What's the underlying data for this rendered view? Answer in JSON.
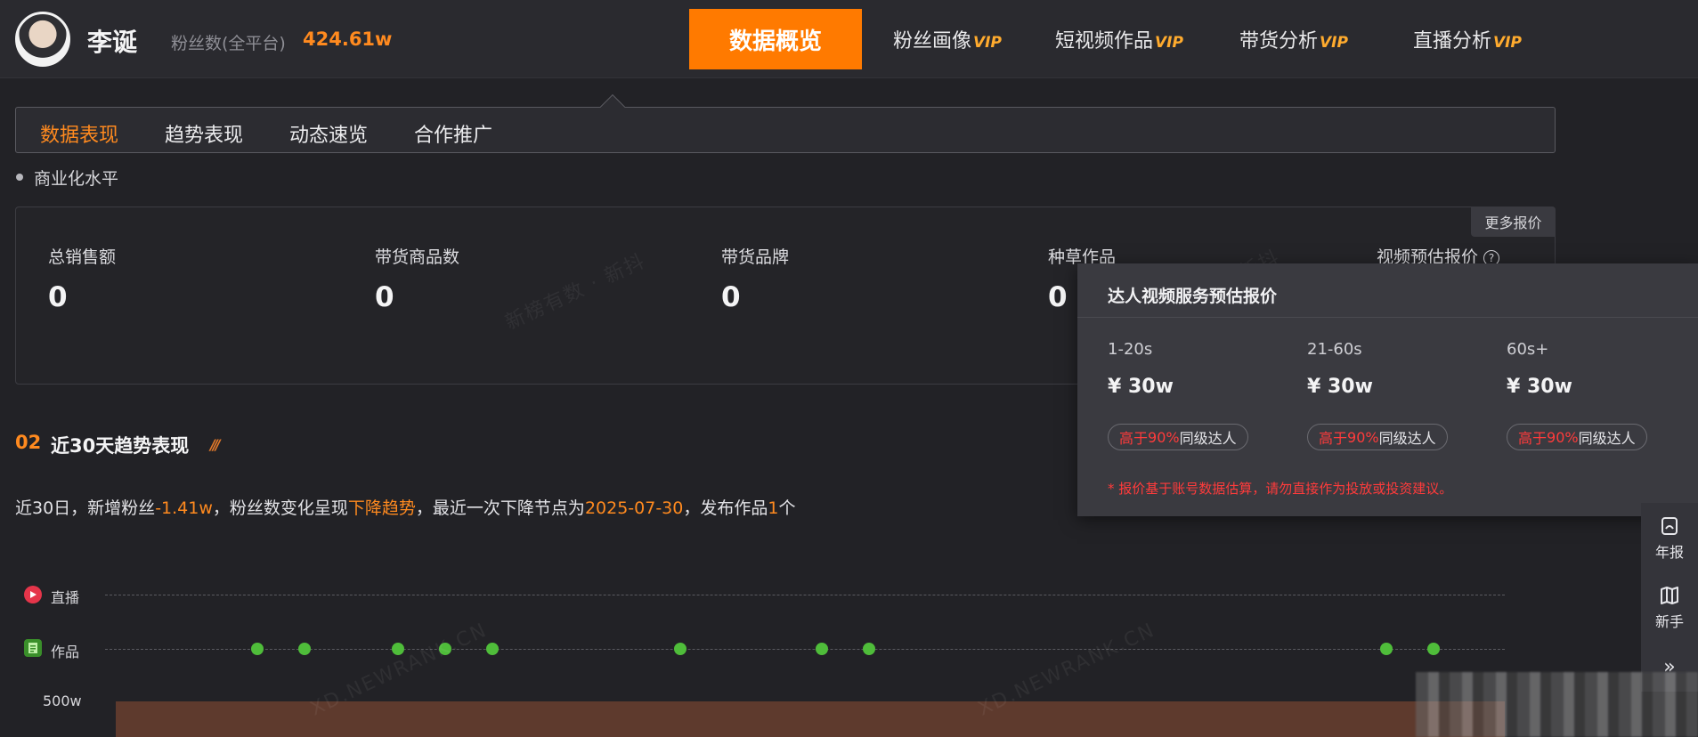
{
  "header": {
    "username": "李诞",
    "fans_label": "粉丝数(全平台)",
    "fans_value": "424.61w",
    "nav": [
      {
        "label": "数据概览",
        "vip": ""
      },
      {
        "label": "粉丝画像",
        "vip": "VIP"
      },
      {
        "label": "短视频作品",
        "vip": "VIP"
      },
      {
        "label": "带货分析",
        "vip": "VIP"
      },
      {
        "label": "直播分析",
        "vip": "VIP"
      }
    ]
  },
  "subtabs": [
    "数据表现",
    "趋势表现",
    "动态速览",
    "合作推广"
  ],
  "section": {
    "title": "商业化水平"
  },
  "stats": {
    "more_quote": "更多报价",
    "items": [
      {
        "label": "总销售额",
        "value": "0"
      },
      {
        "label": "带货商品数",
        "value": "0"
      },
      {
        "label": "带货品牌",
        "value": "0"
      },
      {
        "label": "种草作品",
        "value": "0"
      },
      {
        "label": "视频预估报价",
        "value": ""
      }
    ]
  },
  "trend": {
    "num": "02",
    "title": "近30天趋势表现",
    "summary": {
      "p1": "近30日，新增粉丝",
      "fans_change": "-1.41w",
      "p2": "，粉丝数变化呈现",
      "trend": "下降趋势",
      "p3": "，最近一次下降节点为",
      "date": "2025-07-30",
      "p4": "，发布作品",
      "works": "1",
      "p5": "个"
    }
  },
  "timeline": {
    "lane_live": "直播",
    "lane_works": "作品",
    "y_label": "500w"
  },
  "popup": {
    "title": "达人视频服务预估报价",
    "columns": [
      {
        "range": "1-20s",
        "price": "¥ 30w",
        "badge_pre": "高于",
        "badge_pct": "90%",
        "badge_post": "同级达人"
      },
      {
        "range": "21-60s",
        "price": "¥ 30w",
        "badge_pre": "高于",
        "badge_pct": "90%",
        "badge_post": "同级达人"
      },
      {
        "range": "60s+",
        "price": "¥ 30w",
        "badge_pre": "高于",
        "badge_pct": "90%",
        "badge_post": "同级达人"
      }
    ],
    "note": "* 报价基于账号数据估算，请勿直接作为投放或投资建议。"
  },
  "tools": {
    "annual": "年报",
    "novice": "新手",
    "collapse": "»"
  },
  "watermarks": [
    "新榜有数 · 新抖",
    "新抖",
    "XD.NEWRANK.CN",
    "XD.NEWRANK.CN"
  ],
  "colors": {
    "accent": "#ff7a00",
    "dot_green": "#4fbd3a",
    "warning_red": "#ff3b3b"
  }
}
